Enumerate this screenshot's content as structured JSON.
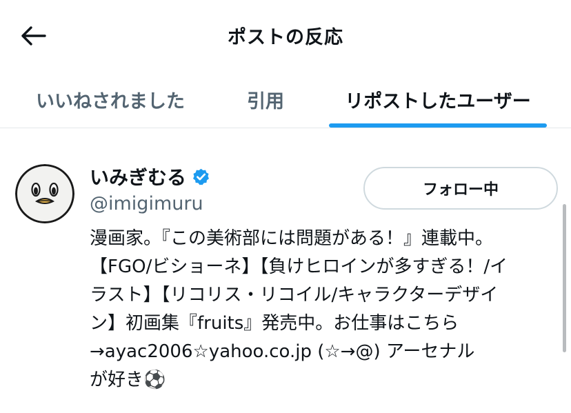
{
  "header": {
    "title": "ポストの反応",
    "back_icon": "arrow-left-icon"
  },
  "tabs": [
    {
      "label": "いいねされました",
      "active": false
    },
    {
      "label": "引用",
      "active": false
    },
    {
      "label": "リポストしたユーザー",
      "active": true
    }
  ],
  "user": {
    "display_name": "いみぎむる",
    "verified": true,
    "handle": "@imigimuru",
    "follow_button_label": "フォロー中",
    "bio_lines": [
      "漫画家。『この美術部には問題がある！』連載中。",
      "【FGO/ビショーネ】【負けヒロインが多すぎる！/イ",
      "ラスト】【リコリス・リコイル/キャラクターデザイ",
      "ン】初画集『fruits』発売中。お仕事はこちら",
      "→ayac2006☆yahoo.co.jp (☆→@) アーセナル",
      "が好き⚽"
    ]
  },
  "colors": {
    "accent": "#1d9bf0",
    "text_primary": "#0f1419",
    "text_secondary": "#536471",
    "verified": "#1d9bf0"
  }
}
